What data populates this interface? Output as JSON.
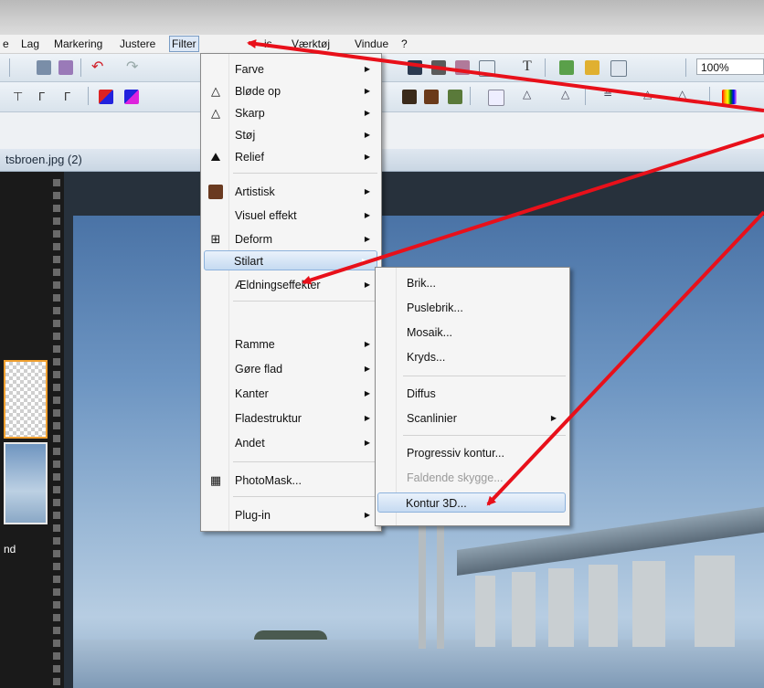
{
  "menubar": {
    "items": [
      "e",
      "Lag",
      "Markering",
      "Justere",
      "Filter",
      "is",
      "Værktøj",
      "Vindue",
      "?"
    ],
    "active": "Filter"
  },
  "toolbar": {
    "zoom": "100%"
  },
  "document": {
    "tab_title": "tsbroen.jpg (2)"
  },
  "filmstrip": {
    "thumb2_label": "nd"
  },
  "filter_menu": {
    "items": [
      {
        "label": "Farve",
        "submenu": true,
        "icon": ""
      },
      {
        "label": "Bløde op",
        "submenu": true,
        "icon": "droplet-icon"
      },
      {
        "label": "Skarp",
        "submenu": true,
        "icon": "triangle-icon"
      },
      {
        "label": "Støj",
        "submenu": true,
        "icon": ""
      },
      {
        "label": "Relief",
        "submenu": true,
        "icon": "relief-icon"
      },
      {
        "label": "Artistisk",
        "submenu": true,
        "icon": "portrait-icon"
      },
      {
        "label": "Visuel effekt",
        "submenu": true,
        "icon": ""
      },
      {
        "label": "Deform",
        "submenu": true,
        "icon": "grid-icon"
      },
      {
        "label": "Stilart",
        "submenu": true,
        "icon": "",
        "highlighted": true
      },
      {
        "label": "Ældningseffekter",
        "submenu": true,
        "icon": ""
      },
      {
        "label": "Ramme",
        "submenu": true,
        "icon": ""
      },
      {
        "label": "Gøre flad",
        "submenu": true,
        "icon": ""
      },
      {
        "label": "Kanter",
        "submenu": true,
        "icon": ""
      },
      {
        "label": "Fladestruktur",
        "submenu": true,
        "icon": ""
      },
      {
        "label": "Andet",
        "submenu": true,
        "icon": ""
      },
      {
        "label": "PhotoMask...",
        "submenu": false,
        "icon": "photomask-icon"
      },
      {
        "label": "Plug-in",
        "submenu": true,
        "icon": ""
      }
    ]
  },
  "stilart_submenu": {
    "items": [
      {
        "label": "Brik..."
      },
      {
        "label": "Puslebrik..."
      },
      {
        "label": "Mosaik..."
      },
      {
        "label": "Kryds..."
      },
      {
        "label": "Diffus"
      },
      {
        "label": "Scanlinier",
        "submenu": true
      },
      {
        "label": "Progressiv kontur..."
      },
      {
        "label": "Faldende skygge...",
        "disabled": true
      },
      {
        "label": "Kontur 3D...",
        "highlighted": true
      }
    ]
  },
  "colors": {
    "annotation_arrow": "#e8101a",
    "highlight_border": "#8db2dc",
    "menu_bg": "#f5f5f5"
  }
}
